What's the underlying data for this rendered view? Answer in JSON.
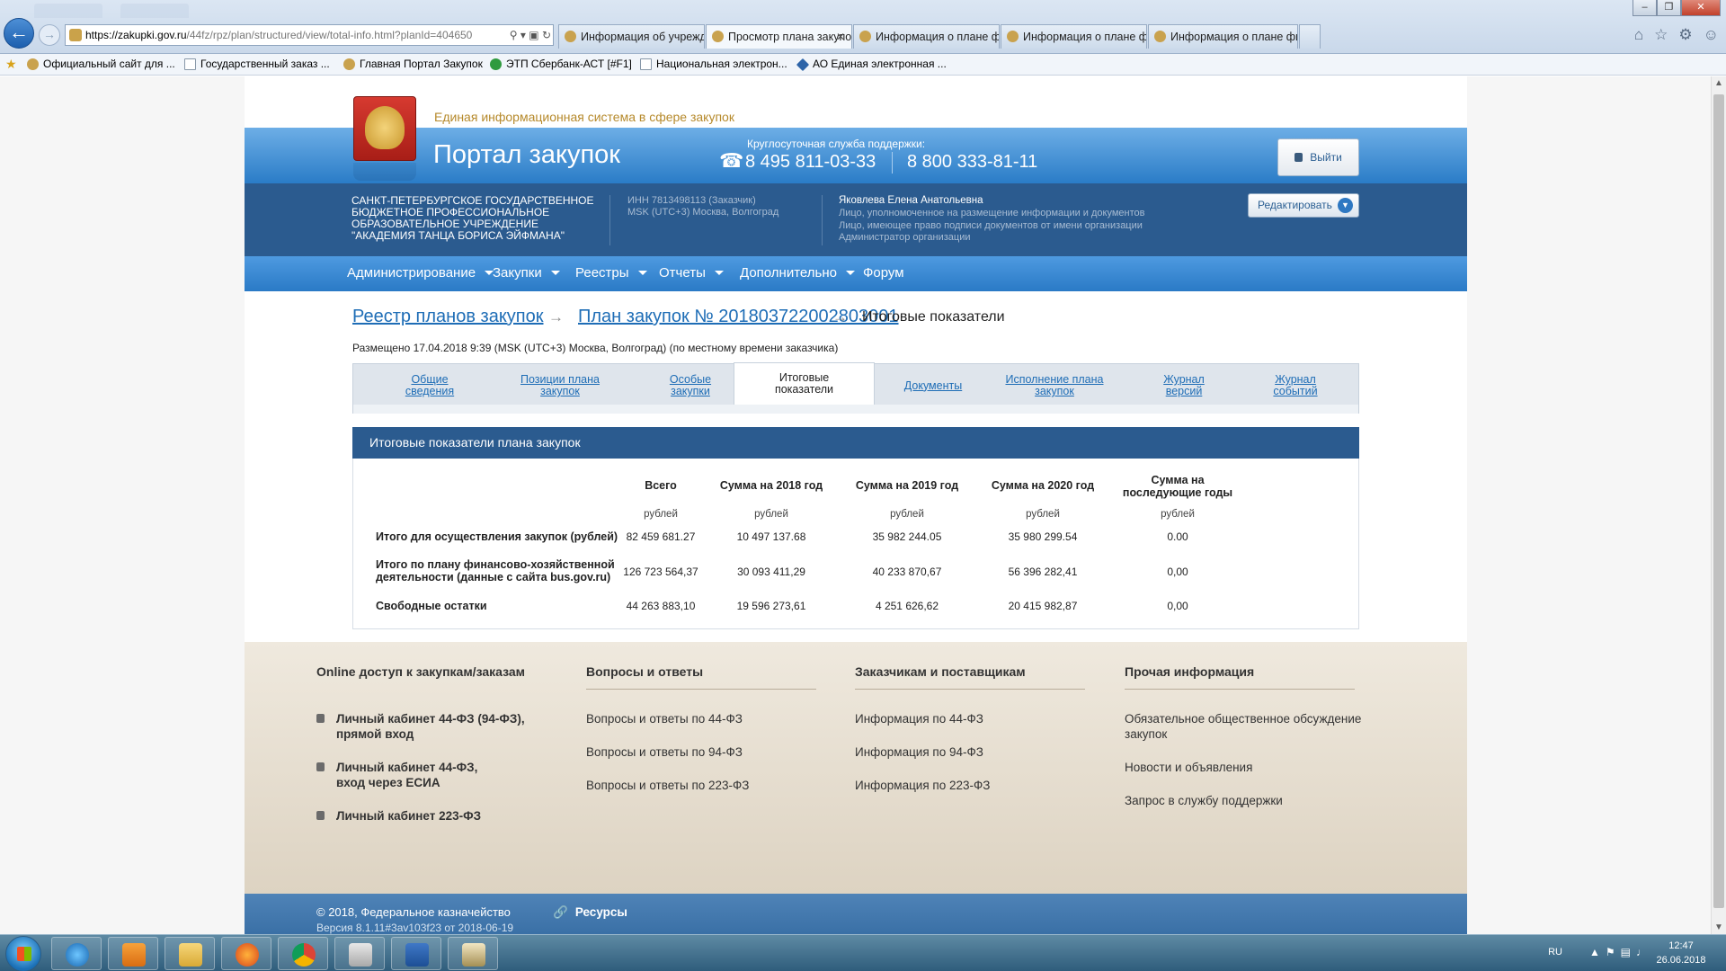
{
  "browser": {
    "url_host": "https://zakupki.gov.ru",
    "url_path": "/44fz/rpz/plan/structured/view/total-info.html?planId=404650",
    "tabs": [
      {
        "label": "Информация об учреждении",
        "active": false
      },
      {
        "label": "Просмотр плана закупок",
        "active": true
      },
      {
        "label": "Информация о плане финан...",
        "active": false
      },
      {
        "label": "Информация о плане финан...",
        "active": false
      },
      {
        "label": "Информация о плане финан...",
        "active": false
      }
    ],
    "bookmarks": [
      "Официальный сайт для ...",
      "Государственный заказ ...",
      "Главная Портал Закупок",
      "ЭТП Сбербанк-АСТ [#F1]",
      "Национальная электрон...",
      "АО Единая электронная ..."
    ]
  },
  "header": {
    "tagline": "Единая информационная система в сфере закупок",
    "portal_title": "Портал закупок",
    "support_label": "Круглосуточная служба поддержки:",
    "phone_1": "8 495 811-03-33",
    "phone_2": "8 800 333-81-11",
    "logout_label": "Выйти"
  },
  "org": {
    "name": "САНКТ-ПЕТЕРБУРГСКОЕ ГОСУДАРСТВЕННОЕ БЮДЖЕТНОЕ ПРОФЕССИОНАЛЬНОЕ ОБРАЗОВАТЕЛЬНОЕ УЧРЕЖДЕНИЕ \"АКАДЕМИЯ ТАНЦА БОРИСА ЭЙФМАНА\"",
    "inn": "ИНН 7813498113 (Заказчик)",
    "timezone": "MSK (UTC+3) Москва, Волгоград",
    "user_name": "Яковлева Елена Анатольевна",
    "role_1": "Лицо, уполномоченное на размещение информации и документов",
    "role_2": "Лицо, имеющее право подписи документов от имени организации",
    "role_3": "Администратор организации",
    "edit_label": "Редактировать"
  },
  "nav": {
    "items": [
      "Администрирование",
      "Закупки",
      "Реестры",
      "Отчеты",
      "Дополнительно",
      "Форум"
    ]
  },
  "breadcrumb": {
    "item_1": "Реестр планов закупок",
    "item_2": "План закупок № 201803722002803001",
    "item_3": "Итоговые показатели"
  },
  "posted": "Размещено 17.04.2018 9:39 (MSK (UTC+3) Москва, Волгоград) (по местному времени заказчика)",
  "plan_tabs": [
    {
      "line1": "Общие",
      "line2": "сведения"
    },
    {
      "line1": "Позиции плана",
      "line2": "закупок"
    },
    {
      "line1": "Особые",
      "line2": "закупки"
    },
    {
      "line1": "Итоговые",
      "line2": "показатели"
    },
    {
      "line1": "Документы",
      "line2": ""
    },
    {
      "line1": "Исполнение плана",
      "line2": "закупок"
    },
    {
      "line1": "Журнал",
      "line2": "версий"
    },
    {
      "line1": "Журнал",
      "line2": "событий"
    }
  ],
  "totals": {
    "title": "Итоговые показатели плана закупок",
    "columns": [
      {
        "line1": "Всего",
        "line2": "",
        "unit": "рублей"
      },
      {
        "line1": "Сумма на 2018 год",
        "line2": "",
        "unit": "рублей"
      },
      {
        "line1": "Сумма на 2019 год",
        "line2": "",
        "unit": "рублей"
      },
      {
        "line1": "Сумма на 2020 год",
        "line2": "",
        "unit": "рублей"
      },
      {
        "line1": "Сумма на",
        "line2": "последующие годы",
        "unit": "рублей"
      }
    ],
    "rows": [
      {
        "label_1": "Итого для осуществления закупок (рублей)",
        "label_2": "",
        "values": [
          "82 459 681.27",
          "10 497 137.68",
          "35 982 244.05",
          "35 980 299.54",
          "0.00"
        ]
      },
      {
        "label_1": "Итого по плану финансово-хозяйственной",
        "label_2": "деятельности (данные с сайта bus.gov.ru)",
        "values": [
          "126 723 564,37",
          "30 093 411,29",
          "40 233 870,67",
          "56 396 282,41",
          "0,00"
        ]
      },
      {
        "label_1": "Свободные остатки",
        "label_2": "",
        "values": [
          "44 263 883,10",
          "19 596 273,61",
          "4 251 626,62",
          "20 415 982,87",
          "0,00"
        ]
      }
    ]
  },
  "footer": {
    "col_1": {
      "heading": "Online доступ к закупкам/заказам",
      "link_1a": "Личный кабинет 44-ФЗ (94-ФЗ),",
      "link_1b": "прямой вход",
      "link_2a": "Личный кабинет 44-ФЗ,",
      "link_2b": "вход через ЕСИА",
      "link_3a": "Личный кабинет 223-ФЗ"
    },
    "col_2": {
      "heading": "Вопросы и ответы",
      "links": [
        "Вопросы и ответы по 44-ФЗ",
        "Вопросы и ответы по 94-ФЗ",
        "Вопросы и ответы по 223-ФЗ"
      ]
    },
    "col_3": {
      "heading": "Заказчикам и поставщикам",
      "links": [
        "Информация по 44-ФЗ",
        "Информация по 94-ФЗ",
        "Информация по 223-ФЗ"
      ]
    },
    "col_4": {
      "heading": "Прочая информация",
      "link_1a": "Обязательное общественное обсуждение",
      "link_1b": "закупок",
      "links": [
        "Новости и объявления",
        "Запрос в службу поддержки"
      ]
    },
    "copyright": "© 2018, Федеральное казначейство",
    "version": "Версия 8.1.11#3аv103f23 от 2018-06-19",
    "resources": "Ресурсы"
  },
  "taskbar": {
    "lang": "RU",
    "time": "12:47",
    "date": "26.06.2018"
  },
  "colors": {
    "header_blue": "#2a7cc7",
    "org_band": "#2b5b8f",
    "link": "#1e6db6",
    "tagline_gold": "#b68a2c"
  }
}
